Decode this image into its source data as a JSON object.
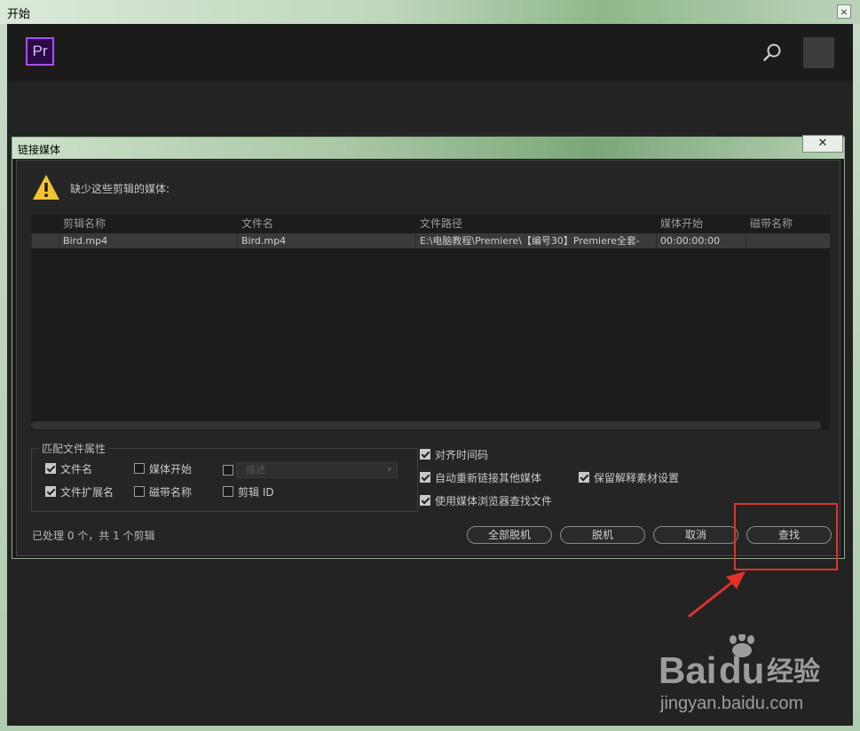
{
  "window": {
    "title": "开始",
    "close_glyph": "×"
  },
  "app": {
    "logo": "Pr",
    "search_icon": "search-icon"
  },
  "dialog": {
    "title": "链接媒体",
    "close_glyph": "✕",
    "warning": "缺少这些剪辑的媒体:",
    "table": {
      "columns": [
        "剪辑名称",
        "文件名",
        "文件路径",
        "媒体开始",
        "磁带名称"
      ],
      "rows": [
        {
          "clip": "Bird.mp4",
          "file": "Bird.mp4",
          "path": "E:\\电脑教程\\Premiere\\【编号30】Premiere全套-",
          "start": "00:00:00:00",
          "tape": ""
        }
      ]
    },
    "match_group": {
      "label": "匹配文件属性",
      "options": [
        {
          "label": "文件名",
          "checked": true
        },
        {
          "label": "媒体开始",
          "checked": false
        },
        {
          "label": "",
          "checked": false
        },
        {
          "label": "文件扩展名",
          "checked": true
        },
        {
          "label": "磁带名称",
          "checked": false
        },
        {
          "label": "剪辑 ID",
          "checked": false
        }
      ],
      "description_placeholder": "描述"
    },
    "options": [
      {
        "label": "对齐时间码",
        "checked": true
      },
      {
        "label": "自动重新链接其他媒体",
        "checked": true
      },
      {
        "label": "保留解释素材设置",
        "checked": true
      },
      {
        "label": "使用媒体浏览器查找文件",
        "checked": true
      }
    ],
    "status": "已处理 0 个，共 1 个剪辑",
    "buttons": {
      "offline_all": "全部脱机",
      "offline": "脱机",
      "cancel": "取消",
      "find": "查找"
    }
  },
  "watermark": {
    "brand": "Baidu经验",
    "url": "jingyan.baidu.com"
  },
  "colors": {
    "highlight": "#e2322b",
    "logo_purple": "#a84fff",
    "warning": "#f2c230"
  }
}
